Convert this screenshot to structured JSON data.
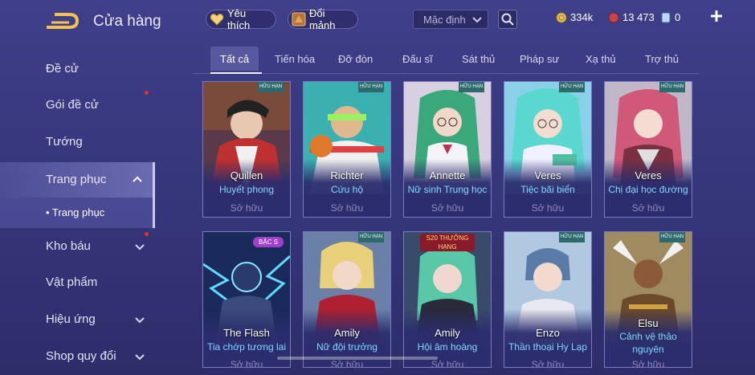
{
  "header": {
    "title": "Cửa hàng",
    "favorites_label": "Yêu thích",
    "exchange_label": "Đổi mảnh",
    "sort_value": "Mặc định",
    "currencies": [
      {
        "icon": "gold-coin-icon",
        "value": "334k"
      },
      {
        "icon": "ruby-icon",
        "value": "13 473"
      },
      {
        "icon": "voucher-icon",
        "value": "0"
      }
    ]
  },
  "sidebar": {
    "items": [
      {
        "label": "Đề cử"
      },
      {
        "label": "Gói đề cử"
      },
      {
        "label": "Tướng"
      },
      {
        "label": "Trang phục"
      },
      {
        "label": "Kho báu"
      },
      {
        "label": "Vật phẩm"
      },
      {
        "label": "Hiệu ứng"
      },
      {
        "label": "Shop quy đổi"
      }
    ],
    "sub_item": "• Trang phục"
  },
  "tabs": [
    "Tất cả",
    "Tiến hóa",
    "Đỡ đòn",
    "Đấu sĩ",
    "Sát thủ",
    "Pháp sư",
    "Xạ thủ",
    "Trợ thủ"
  ],
  "cards": [
    {
      "hero": "Quillen",
      "skin": "Huyết phong",
      "status": "Sở hữu",
      "badge": "HỮU HẠN"
    },
    {
      "hero": "Richter",
      "skin": "Cứu hộ",
      "status": "Sở hữu",
      "badge": "HỮU HẠN"
    },
    {
      "hero": "Annette",
      "skin": "Nữ sinh Trung học",
      "status": "Sở hữu",
      "badge": "HỮU HẠN"
    },
    {
      "hero": "Veres",
      "skin": "Tiệc bãi biển",
      "status": "Sở hữu",
      "badge": "HỮU HẠN"
    },
    {
      "hero": "Veres",
      "skin": "Chị đại học đường",
      "status": "Sở hữu",
      "badge": "HỮU HẠN"
    },
    {
      "hero": "The Flash",
      "skin": "Tia chớp tương lai",
      "status": "Sở hữu",
      "badge": "BẬC S"
    },
    {
      "hero": "Amily",
      "skin": "Nữ đội trưởng",
      "status": "Sở hữu",
      "badge": "HỮU HẠN"
    },
    {
      "hero": "Amily",
      "skin": "Hội âm hoàng",
      "status": "Sở hữu",
      "badge": "S20 THƯỞNG HẠNG"
    },
    {
      "hero": "Enzo",
      "skin": "Thần thoại Hy Lạp",
      "status": "Sở hữu",
      "badge": "HỮU HẠN"
    },
    {
      "hero": "Elsu",
      "skin": "Cảnh vệ thảo nguyên",
      "status": "Sở hữu",
      "badge": "HỮU HẠN"
    }
  ]
}
